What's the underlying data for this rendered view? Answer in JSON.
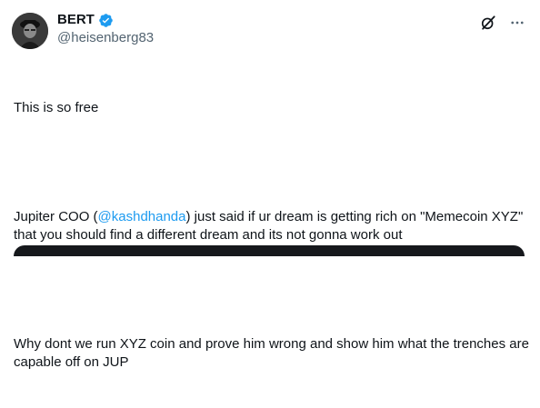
{
  "author": {
    "display_name": "BERT",
    "handle": "@heisenberg83",
    "verified": true
  },
  "actions": {
    "grok_icon": "grok-icon",
    "more_icon": "more-icon"
  },
  "tweet": {
    "line1": "This is so free",
    "p2_before": "Jupiter COO (",
    "p2_mention": "@kashdhanda",
    "p2_after": ") just said if ur dream is getting rich on \"Memecoin XYZ\" that you should find a different dream and its not gonna work out",
    "p3": "Why dont we run XYZ coin and prove him wrong and show him what the trenches are capable off on JUP"
  },
  "colors": {
    "link": "#1d9bf0",
    "secondary": "#536471",
    "text": "#0f1419"
  }
}
